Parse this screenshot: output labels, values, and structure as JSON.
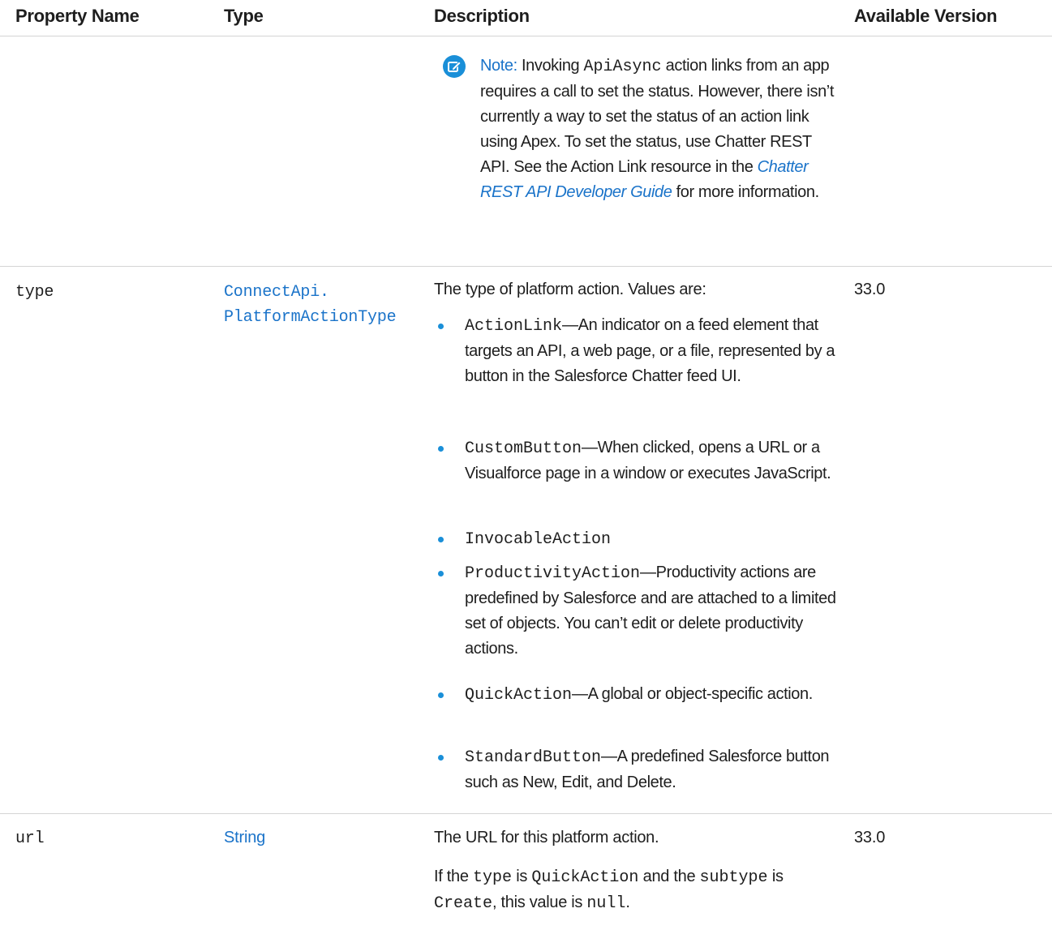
{
  "header": {
    "col_property_name": "Property Name",
    "col_type": "Type",
    "col_description": "Description",
    "col_available_version": "Available Version"
  },
  "note": {
    "label": "Note:",
    "text_1": "Invoking",
    "code_1": "ApiAsync",
    "text_2": "action links from an app requires a call to set the status. However, there isn’t currently a way to set the status of an action link using Apex. To set the status, use Chatter REST API. See the Action Link resource in the",
    "link_text": "Chatter REST API Developer Guide",
    "text_3": "for more information."
  },
  "rows": [
    {
      "name": "type",
      "type_line1": "ConnectApi.",
      "type_line2": "PlatformActionType",
      "description_intro": "The type of platform action. Values are:",
      "version": "33.0",
      "values": [
        {
          "code": "ActionLink",
          "text": "—An indicator on a feed element that targets an API, a web page, or a file, represented by a button in the Salesforce Chatter feed UI."
        },
        {
          "code": "CustomButton",
          "text": "—When clicked, opens a URL or a Visualforce page in a window or executes JavaScript."
        },
        {
          "code": "InvocableAction",
          "text": ""
        },
        {
          "code": "ProductivityAction",
          "text": "—Productivity actions are predefined by Salesforce and are attached to a limited set of objects. You can’t edit or delete productivity actions."
        },
        {
          "code": "QuickAction",
          "text": "—A global or object-specific action."
        },
        {
          "code": "StandardButton",
          "text": "—A predefined Salesforce button such as New, Edit, and Delete."
        }
      ]
    },
    {
      "name": "url",
      "type_line1": "String",
      "description_intro": "The URL for this platform action.",
      "version": "33.0",
      "extra": {
        "t1": "If the",
        "c1": "type",
        "t2": "is",
        "c2": "QuickAction",
        "t3": "and the",
        "c3": "subtype",
        "t4": "is",
        "c4": "Create",
        "t5": ", this value is",
        "c5": "null",
        "t6": "."
      }
    }
  ],
  "colors": {
    "link": "#1a73c9",
    "bullet": "#1a8fd8",
    "divider": "#d4d4d4"
  },
  "icons": {
    "note": "edit-note-icon"
  }
}
